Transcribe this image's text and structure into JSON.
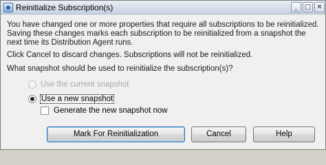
{
  "window": {
    "title": "Reinitialize Subscription(s)",
    "controls": {
      "minimize": "_",
      "maximize": "□",
      "close": "✕"
    }
  },
  "message": {
    "line1": "You have changed one or more properties that require all subscriptions to be reinitialized. Saving these changes marks each subscription to be reinitialized from a snapshot the next time its Distribution Agent runs.",
    "line2": "Click Cancel to discard changes. Subscriptions will not be reinitialized.",
    "question": "What snapshot should be used to reinitialize the subscription(s)?"
  },
  "options": {
    "use_current": {
      "label": "Use the current snapshot",
      "checked": false,
      "enabled": false
    },
    "use_new": {
      "label": "Use a new snapshot",
      "checked": true,
      "enabled": true
    },
    "generate_now": {
      "label": "Generate the new snapshot now",
      "checked": false
    }
  },
  "buttons": {
    "mark": "Mark For Reinitialization",
    "cancel": "Cancel",
    "help": "Help"
  }
}
